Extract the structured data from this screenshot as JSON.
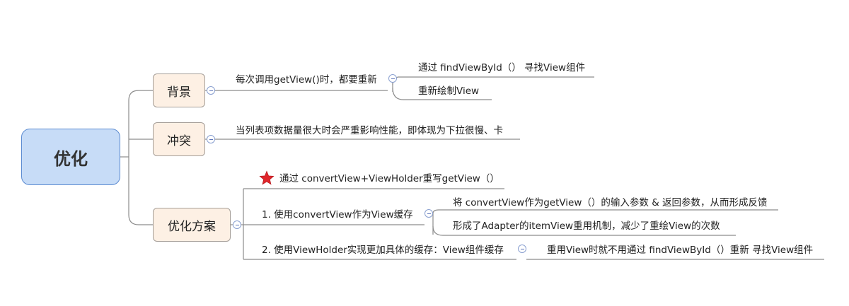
{
  "root": {
    "label": "优化"
  },
  "branches": {
    "background": {
      "label": "背景",
      "detail": "每次调用getView()时，都要重新",
      "children": [
        "通过 findViewById（） 寻找View组件",
        "重新绘制View"
      ]
    },
    "conflict": {
      "label": "冲突",
      "detail": "当列表项数据量很大时会严重影响性能，即体现为下拉很慢、卡"
    },
    "solution": {
      "label": "优化方案",
      "summary": "通过 convertView+ViewHolder重写getView（）",
      "step1": {
        "label": "1. 使用convertView作为View缓存",
        "children": [
          "将 convertView作为getView（）的输入参数 & 返回参数，从而形成反馈",
          "形成了Adapter的itemView重用机制，减少了重绘View的次数"
        ]
      },
      "step2": {
        "label": "2. 使用ViewHolder实现更加具体的缓存：View组件缓存",
        "child": "重用View时就不用通过 findViewById（）重新 寻找View组件"
      }
    }
  },
  "colors": {
    "root_fill": "#c7dcf7",
    "root_border": "#5b8bd1",
    "branch_fill": "#fdf0e4",
    "line": "#8c8c8c",
    "star": "#e0262b"
  },
  "icons": {
    "collapse": "collapse-toggle-icon",
    "star": "star-icon"
  }
}
